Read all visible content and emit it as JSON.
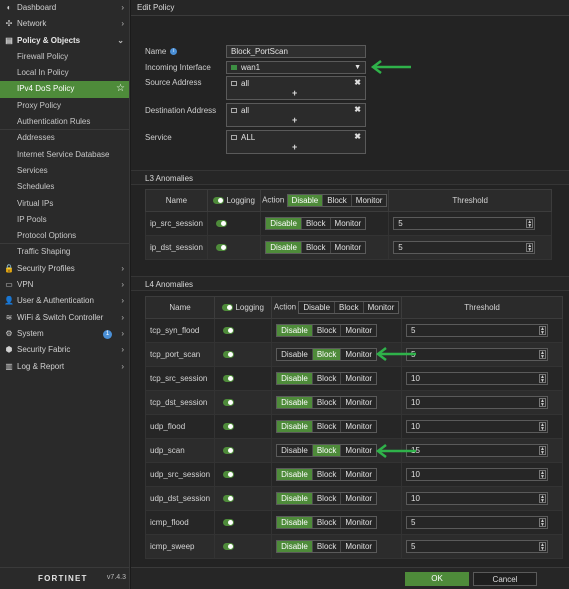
{
  "sidebar": {
    "items": [
      {
        "label": "Dashboard",
        "icon": "dashboard-icon",
        "glyph": "◐"
      },
      {
        "label": "Network",
        "icon": "network-icon",
        "glyph": "✣"
      },
      {
        "label": "Policy & Objects",
        "icon": "policy-icon",
        "glyph": "▤"
      },
      {
        "label": "Firewall Policy"
      },
      {
        "label": "Local In Policy"
      },
      {
        "label": "IPv4 DoS Policy"
      },
      {
        "label": "Proxy Policy"
      },
      {
        "label": "Authentication Rules"
      },
      {
        "label": "Addresses"
      },
      {
        "label": "Internet Service Database"
      },
      {
        "label": "Services"
      },
      {
        "label": "Schedules"
      },
      {
        "label": "Virtual IPs"
      },
      {
        "label": "IP Pools"
      },
      {
        "label": "Protocol Options"
      },
      {
        "label": "Traffic Shaping"
      },
      {
        "label": "Security Profiles",
        "icon": "lock-icon",
        "glyph": "🔒"
      },
      {
        "label": "VPN",
        "icon": "vpn-icon",
        "glyph": "▭"
      },
      {
        "label": "User & Authentication",
        "icon": "user-icon",
        "glyph": "👤"
      },
      {
        "label": "WiFi & Switch Controller",
        "icon": "wifi-icon",
        "glyph": "≋"
      },
      {
        "label": "System",
        "icon": "gear-icon",
        "glyph": "⚙",
        "badge": "1"
      },
      {
        "label": "Security Fabric",
        "icon": "fabric-icon",
        "glyph": "⬢"
      },
      {
        "label": "Log & Report",
        "icon": "log-icon",
        "glyph": "▥"
      }
    ],
    "logo": "F RTINET",
    "logo_o": "O",
    "version": "v7.4.3"
  },
  "main": {
    "title": "Edit Policy",
    "name_label": "Name",
    "name_value": "Block_PortScan",
    "incoming_label": "Incoming Interface",
    "incoming_value": "wan1",
    "source_label": "Source Address",
    "source_value": "all",
    "dest_label": "Destination Address",
    "dest_value": "all",
    "service_label": "Service",
    "service_value": "ALL",
    "plus": "+",
    "remove": "✖"
  },
  "l3": {
    "title": "L3 Anomalies",
    "headers": {
      "name": "Name",
      "logging": "Logging",
      "action": "Action",
      "threshold": "Threshold"
    },
    "action_options": [
      "Disable",
      "Block",
      "Monitor"
    ],
    "rows": [
      {
        "name": "ip_src_session",
        "action": "Disable",
        "threshold": "5"
      },
      {
        "name": "ip_dst_session",
        "action": "Disable",
        "threshold": "5"
      }
    ]
  },
  "l4": {
    "title": "L4 Anomalies",
    "headers": {
      "name": "Name",
      "logging": "Logging",
      "action": "Action",
      "threshold": "Threshold"
    },
    "action_options": [
      "Disable",
      "Block",
      "Monitor"
    ],
    "rows": [
      {
        "name": "tcp_syn_flood",
        "action": "Disable",
        "threshold": "5"
      },
      {
        "name": "tcp_port_scan",
        "action": "Block",
        "threshold": "5"
      },
      {
        "name": "tcp_src_session",
        "action": "Disable",
        "threshold": "10"
      },
      {
        "name": "tcp_dst_session",
        "action": "Disable",
        "threshold": "10"
      },
      {
        "name": "udp_flood",
        "action": "Disable",
        "threshold": "10"
      },
      {
        "name": "udp_scan",
        "action": "Block",
        "threshold": "15"
      },
      {
        "name": "udp_src_session",
        "action": "Disable",
        "threshold": "10"
      },
      {
        "name": "udp_dst_session",
        "action": "Disable",
        "threshold": "10"
      },
      {
        "name": "icmp_flood",
        "action": "Disable",
        "threshold": "5"
      },
      {
        "name": "icmp_sweep",
        "action": "Disable",
        "threshold": "5"
      }
    ]
  },
  "footer": {
    "ok": "OK",
    "cancel": "Cancel"
  },
  "colors": {
    "accent": "#4e8b3a",
    "annotation_arrow": "#2fb24a"
  }
}
